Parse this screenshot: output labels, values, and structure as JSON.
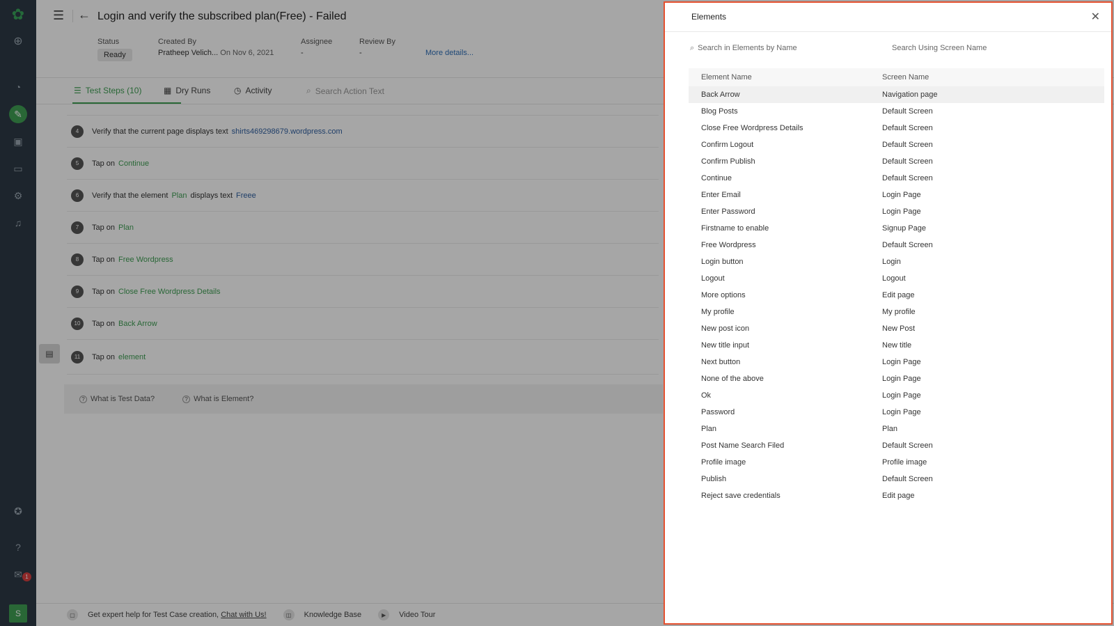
{
  "nav": {
    "avatar_letter": "S",
    "gift_badge": "1",
    "accent_color": "#3f9e54"
  },
  "header": {
    "title": "Login and verify the subscribed plan(Free) - Failed",
    "status_label": "Status",
    "status_value": "Ready",
    "created_label": "Created By",
    "created_by": "Pratheep Velich...",
    "created_on": "On Nov 6, 2021",
    "assignee_label": "Assignee",
    "assignee_value": "-",
    "review_label": "Review By",
    "review_value": "-",
    "more_details": "More details..."
  },
  "tabs": {
    "steps": "Test Steps (10)",
    "dry_runs": "Dry Runs",
    "activity": "Activity",
    "search_placeholder": "Search Action Text"
  },
  "steps": [
    {
      "num": "4",
      "text": "Verify that the current page displays text",
      "data": "shirts469298679.wordpress.com"
    },
    {
      "num": "5",
      "text": "Tap on",
      "link": "Continue"
    },
    {
      "num": "6",
      "text": "Verify that the element",
      "link": "Plan",
      "text2": "displays text",
      "data": "Freee"
    },
    {
      "num": "7",
      "text": "Tap on",
      "link": "Plan"
    },
    {
      "num": "8",
      "text": "Tap on",
      "link": "Free Wordpress"
    },
    {
      "num": "9",
      "text": "Tap on",
      "link": "Close Free Wordpress Details"
    },
    {
      "num": "10",
      "text": "Tap on",
      "link": "Back Arrow"
    },
    {
      "num": "11",
      "text": "Tap on",
      "link": "element"
    }
  ],
  "help": {
    "test_data": "What is Test Data?",
    "element": "What is Element?"
  },
  "footer": {
    "expert_help": "Get expert help for Test Case creation,",
    "chat": "Chat with Us!",
    "knowledge": "Knowledge Base",
    "video": "Video Tour"
  },
  "drawer": {
    "title": "Elements",
    "search_placeholder": "Search in Elements by Name",
    "screen_placeholder": "Search Using Screen Name",
    "col_element": "Element Name",
    "col_screen": "Screen Name",
    "border_color": "#e4502f",
    "rows": [
      {
        "element": "Back Arrow",
        "screen": "Navigation page"
      },
      {
        "element": "Blog Posts",
        "screen": "Default Screen"
      },
      {
        "element": "Close Free Wordpress Details",
        "screen": "Default Screen"
      },
      {
        "element": "Confirm Logout",
        "screen": "Default Screen"
      },
      {
        "element": "Confirm Publish",
        "screen": "Default Screen"
      },
      {
        "element": "Continue",
        "screen": "Default Screen"
      },
      {
        "element": "Enter Email",
        "screen": "Login Page"
      },
      {
        "element": "Enter Password",
        "screen": "Login Page"
      },
      {
        "element": "Firstname to enable",
        "screen": "Signup Page"
      },
      {
        "element": "Free Wordpress",
        "screen": "Default Screen"
      },
      {
        "element": "Login button",
        "screen": "Login"
      },
      {
        "element": "Logout",
        "screen": "Logout"
      },
      {
        "element": "More options",
        "screen": "Edit page"
      },
      {
        "element": "My profile",
        "screen": "My profile"
      },
      {
        "element": "New post icon",
        "screen": "New Post"
      },
      {
        "element": "New title input",
        "screen": "New title"
      },
      {
        "element": "Next button",
        "screen": "Login Page"
      },
      {
        "element": "None of the above",
        "screen": "Login Page"
      },
      {
        "element": "Ok",
        "screen": "Login Page"
      },
      {
        "element": "Password",
        "screen": "Login Page"
      },
      {
        "element": "Plan",
        "screen": "Plan"
      },
      {
        "element": "Post Name Search Filed",
        "screen": "Default Screen"
      },
      {
        "element": "Profile image",
        "screen": "Profile image"
      },
      {
        "element": "Publish",
        "screen": "Default Screen"
      },
      {
        "element": "Reject save credentials",
        "screen": "Edit page"
      }
    ]
  }
}
